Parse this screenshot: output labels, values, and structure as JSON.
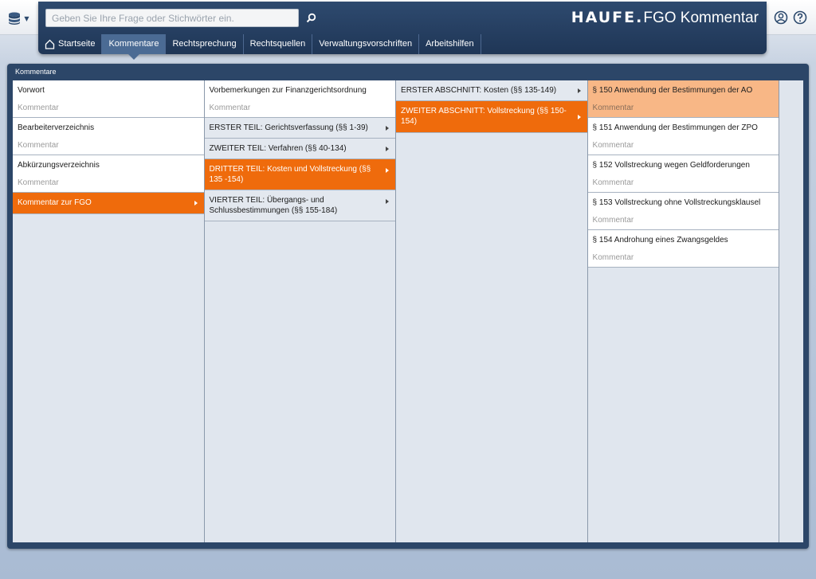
{
  "header": {
    "search_placeholder": "Geben Sie Ihre Frage oder Stichwörter ein.",
    "brand_logo": "HAUFE.",
    "brand_product": "FGO Kommentar"
  },
  "nav": {
    "tabs": [
      {
        "label": "Startseite"
      },
      {
        "label": "Kommentare"
      },
      {
        "label": "Rechtsprechung"
      },
      {
        "label": "Rechtsquellen"
      },
      {
        "label": "Verwaltungsvorschriften"
      },
      {
        "label": "Arbeitshilfen"
      }
    ]
  },
  "panel": {
    "title": "Kommentare",
    "col1": [
      {
        "title": "Vorwort",
        "sub": "Kommentar"
      },
      {
        "title": "Bearbeiterverzeichnis",
        "sub": "Kommentar"
      },
      {
        "title": "Abkürzungsverzeichnis",
        "sub": "Kommentar"
      },
      {
        "title": "Kommentar zur FGO"
      }
    ],
    "col2": [
      {
        "title": "Vorbemerkungen zur Finanzgerichtsordnung",
        "sub": "Kommentar"
      },
      {
        "title": "ERSTER TEIL: Gerichtsverfassung (§§ 1-39)"
      },
      {
        "title": "ZWEITER TEIL: Verfahren (§§ 40-134)"
      },
      {
        "title": "DRITTER TEIL: Kosten und Vollstreckung (§§ 135 -154)"
      },
      {
        "title": "VIERTER TEIL: Übergangs- und Schlussbestimmungen (§§ 155-184)"
      }
    ],
    "col3": [
      {
        "title": "ERSTER ABSCHNITT: Kosten (§§ 135-149)"
      },
      {
        "title": "ZWEITER ABSCHNITT: Vollstreckung (§§ 150-154)"
      }
    ],
    "col4": [
      {
        "title": "§ 150 Anwendung der Bestimmungen der AO",
        "sub": "Kommentar"
      },
      {
        "title": "§ 151 Anwendung der Bestimmungen der ZPO",
        "sub": "Kommentar"
      },
      {
        "title": "§ 152 Vollstreckung wegen Geldforderungen",
        "sub": "Kommentar"
      },
      {
        "title": "§ 153 Vollstreckung ohne Vollstreckungsklausel",
        "sub": "Kommentar"
      },
      {
        "title": "§ 154 Androhung eines Zwangsgeldes",
        "sub": "Kommentar"
      }
    ]
  },
  "colors": {
    "accent_orange": "#ef6b0c",
    "accent_light_orange": "#f8b786",
    "header_navy": "#1f3656"
  },
  "icons": {
    "db": "database-icon",
    "search": "search-icon",
    "home": "home-icon",
    "user": "user-icon",
    "help": "help-icon"
  }
}
